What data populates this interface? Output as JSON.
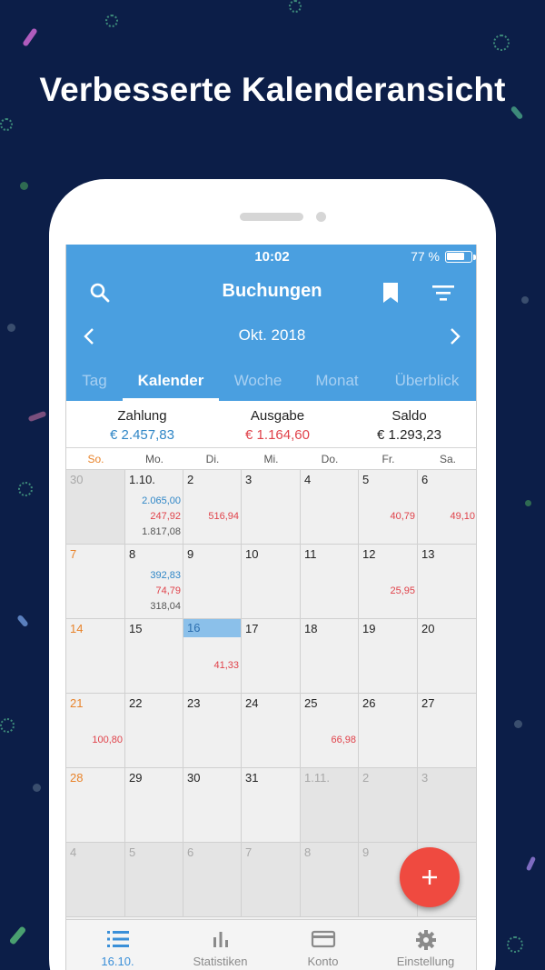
{
  "headline": "Verbesserte Kalenderansicht",
  "colors": {
    "background": "#0c1e48",
    "primary": "#4a9fe0",
    "payment": "#2f86c6",
    "expense": "#e0424a",
    "sunday": "#e8832a",
    "fab": "#ef4a40"
  },
  "status": {
    "time": "10:02",
    "battery_text": "77 %",
    "battery_level": 0.77
  },
  "appbar": {
    "title": "Buchungen",
    "search_icon": "search-icon",
    "bookmark_icon": "bookmark-icon",
    "filter_icon": "filter-icon"
  },
  "month": {
    "label": "Okt. 2018"
  },
  "tabs": [
    {
      "label": "Tag"
    },
    {
      "label": "Kalender"
    },
    {
      "label": "Woche"
    },
    {
      "label": "Monat"
    },
    {
      "label": "Überblick"
    }
  ],
  "active_tab": "Kalender",
  "summary": {
    "payment_label": "Zahlung",
    "payment_value": "€ 2.457,83",
    "expense_label": "Ausgabe",
    "expense_value": "€ 1.164,60",
    "balance_label": "Saldo",
    "balance_value": "€ 1.293,23"
  },
  "weekdays": [
    "So.",
    "Mo.",
    "Di.",
    "Mi.",
    "Do.",
    "Fr.",
    "Sa."
  ],
  "weeks": [
    [
      {
        "day": "30",
        "out": true,
        "grey": true
      },
      {
        "day": "1.10.",
        "amounts": [
          {
            "v": "2.065,00",
            "t": "pay"
          },
          {
            "v": "247,92",
            "t": "exp"
          },
          {
            "v": "1.817,08",
            "t": "bal"
          }
        ]
      },
      {
        "day": "2",
        "amounts": [
          {
            "v": "516,94",
            "t": "exp",
            "slot": 1
          }
        ]
      },
      {
        "day": "3"
      },
      {
        "day": "4"
      },
      {
        "day": "5",
        "amounts": [
          {
            "v": "40,79",
            "t": "exp",
            "slot": 1
          }
        ]
      },
      {
        "day": "6",
        "amounts": [
          {
            "v": "49,10",
            "t": "exp",
            "slot": 1
          }
        ]
      }
    ],
    [
      {
        "day": "7",
        "sun": true
      },
      {
        "day": "8",
        "amounts": [
          {
            "v": "392,83",
            "t": "pay"
          },
          {
            "v": "74,79",
            "t": "exp"
          },
          {
            "v": "318,04",
            "t": "bal"
          }
        ]
      },
      {
        "day": "9"
      },
      {
        "day": "10"
      },
      {
        "day": "11"
      },
      {
        "day": "12",
        "amounts": [
          {
            "v": "25,95",
            "t": "exp",
            "slot": 1
          }
        ]
      },
      {
        "day": "13"
      }
    ],
    [
      {
        "day": "14",
        "sun": true
      },
      {
        "day": "15"
      },
      {
        "day": "16",
        "today": true,
        "amounts": [
          {
            "v": "41,33",
            "t": "exp",
            "slot": 1
          }
        ]
      },
      {
        "day": "17"
      },
      {
        "day": "18"
      },
      {
        "day": "19"
      },
      {
        "day": "20"
      }
    ],
    [
      {
        "day": "21",
        "sun": true,
        "amounts": [
          {
            "v": "100,80",
            "t": "exp",
            "slot": 1
          }
        ]
      },
      {
        "day": "22"
      },
      {
        "day": "23"
      },
      {
        "day": "24"
      },
      {
        "day": "25",
        "amounts": [
          {
            "v": "66,98",
            "t": "exp",
            "slot": 1
          }
        ]
      },
      {
        "day": "26"
      },
      {
        "day": "27"
      }
    ],
    [
      {
        "day": "28",
        "sun": true
      },
      {
        "day": "29"
      },
      {
        "day": "30"
      },
      {
        "day": "31"
      },
      {
        "day": "1.11.",
        "out": true,
        "grey": true
      },
      {
        "day": "2",
        "out": true,
        "grey": true
      },
      {
        "day": "3",
        "out": true,
        "grey": true
      }
    ],
    [
      {
        "day": "4",
        "out": true,
        "grey": true
      },
      {
        "day": "5",
        "out": true,
        "grey": true
      },
      {
        "day": "6",
        "out": true,
        "grey": true
      },
      {
        "day": "7",
        "out": true,
        "grey": true
      },
      {
        "day": "8",
        "out": true,
        "grey": true
      },
      {
        "day": "9",
        "out": true,
        "grey": true
      },
      {
        "day": "",
        "out": true,
        "grey": true
      }
    ]
  ],
  "fab": {
    "icon": "plus-icon",
    "label": "+"
  },
  "bottom_nav": [
    {
      "label": "16.10.",
      "icon": "list-icon",
      "active": true
    },
    {
      "label": "Statistiken",
      "icon": "bar-chart-icon"
    },
    {
      "label": "Konto",
      "icon": "credit-card-icon"
    },
    {
      "label": "Einstellung",
      "icon": "gear-icon"
    }
  ]
}
